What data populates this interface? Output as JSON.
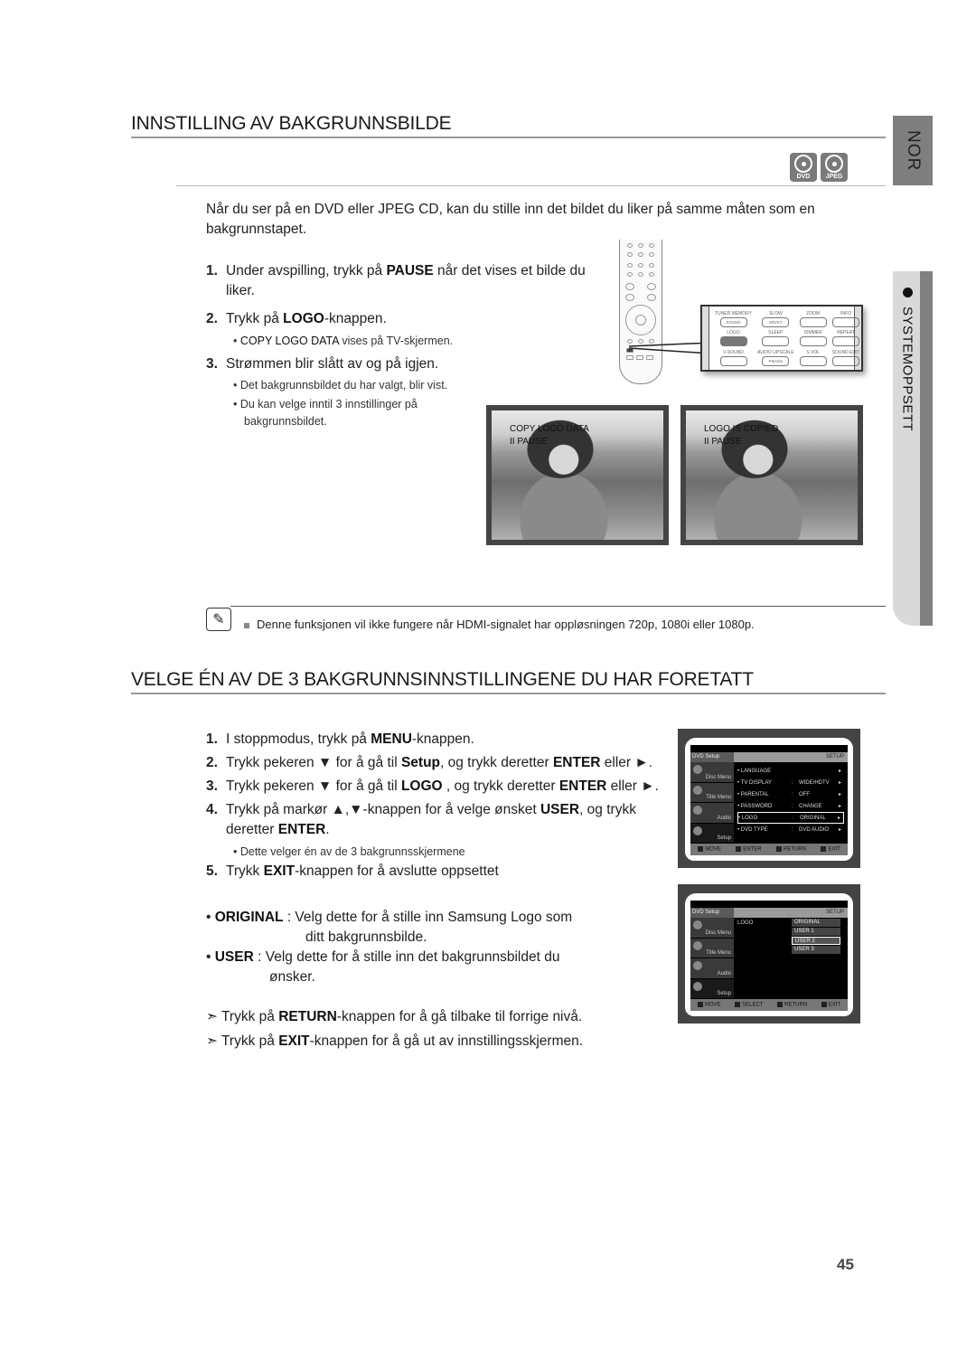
{
  "side_tabs": {
    "language": "NOR",
    "section": "SYSTEMOPPSETT"
  },
  "section1": {
    "title": "INNSTILLING AV BAKGRUNNSBILDE",
    "badges": [
      {
        "icon": "dvd-disc-icon",
        "label": "DVD"
      },
      {
        "icon": "jpeg-disc-icon",
        "label": "JPEG"
      }
    ],
    "intro_line1": "Når du ser på en DVD eller JPEG CD, kan du stille inn det bildet du liker på samme måten som en",
    "intro_line2": "bakgrunnstapet.",
    "steps": [
      {
        "num": "1.",
        "pre": "Under avspilling, trykk på ",
        "bold": "PAUSE",
        "post": " når det vises et bilde du",
        "line2": "liker."
      },
      {
        "num": "2.",
        "pre": "Trykk på ",
        "bold": "LOGO",
        "post": "-knappen.",
        "sub": [
          {
            "bold": "COPY LOGO DATA",
            "post": " vises på TV-skjermen."
          }
        ]
      },
      {
        "num": "3.",
        "pre": "Strømmen blir slått av og på igjen.",
        "sub": [
          {
            "text": "Det bakgrunnsbildet du har valgt, blir vist."
          },
          {
            "text": "Du kan velge inntil 3 innstillinger på",
            "line2": "bakgrunnsbildet."
          }
        ]
      }
    ],
    "remote_keys": [
      {
        "top": "TUNER MEMORY",
        "key": "SOUND"
      },
      {
        "top": "SLOW",
        "key": "MO/ST"
      },
      {
        "top": "ZOOM",
        "key": ""
      },
      {
        "top": "INFO",
        "key": ""
      },
      {
        "top": "LOGO",
        "key": "",
        "active": true
      },
      {
        "top": "SLEEP",
        "key": ""
      },
      {
        "top": "DIMMER",
        "key": ""
      },
      {
        "top": "REPEAT",
        "key": ""
      },
      {
        "top": "V-SOUND",
        "key": ""
      },
      {
        "top": "AUDIO UPSCALE",
        "key": "P.BASS"
      },
      {
        "top": "S.VOL",
        "key": ""
      },
      {
        "top": "SOUND EDIT",
        "key": ""
      }
    ],
    "screens": [
      {
        "line1": "COPY LOGO DATA",
        "line2": "II PAUSE"
      },
      {
        "line1": "LOGO IS COPIED",
        "line2": "II PAUSE"
      }
    ],
    "note": "Denne funksjonen vil ikke fungere når HDMI-signalet har oppløsningen 720p, 1080i eller 1080p."
  },
  "section2": {
    "title": "VELGE ÉN AV DE 3 BAKGRUNNSINNSTILLINGENE DU HAR FORETATT",
    "steps": [
      {
        "num": "1.",
        "parts": [
          "I stoppmodus, trykk på ",
          "MENU",
          "-knappen."
        ]
      },
      {
        "num": "2.",
        "parts": [
          "Trykk pekeren ▼  for å gå til ",
          "Setup",
          ", og trykk deretter ",
          "ENTER",
          " eller ►."
        ]
      },
      {
        "num": "3.",
        "parts": [
          "Trykk pekeren ▼ for å gå til ",
          "LOGO",
          " , og trykk deretter ",
          "ENTER",
          " eller ►."
        ]
      },
      {
        "num": "4.",
        "parts": [
          "Trykk på markør ▲,▼-knappen for å velge ønsket ",
          "USER",
          ", og trykk"
        ],
        "line2": [
          "deretter ",
          "ENTER",
          "."
        ],
        "sub": "Dette velger én av de 3 bakgrunnsskjermene"
      },
      {
        "num": "5.",
        "parts": [
          "Trykk ",
          "EXIT",
          "-knappen for å avslutte oppsettet"
        ]
      }
    ],
    "options": [
      {
        "bold": "ORIGINAL",
        "text": " : Velg dette for å stille inn Samsung Logo som",
        "line2": "ditt bakgrunnsbilde."
      },
      {
        "bold": "USER",
        "text": " : Velg dette for å stille inn det bakgrunnsbildet du",
        "line2": "ønsker."
      }
    ],
    "tips": [
      {
        "pre": "Trykk på ",
        "bold": "RETURN",
        "post": "-knappen for å gå tilbake til forrige nivå."
      },
      {
        "pre": "Trykk på ",
        "bold": "EXIT",
        "post": "-knappen for å gå ut av innstillingsskjermen."
      }
    ],
    "menu1": {
      "header_left": "DVD Setup",
      "header_right": "SETUP",
      "sidebar": [
        "Disc Menu",
        "Title Menu",
        "Audio",
        "Setup"
      ],
      "rows": [
        {
          "name": "LANGUAGE",
          "value": ""
        },
        {
          "name": "TV DISPLAY",
          "value": "WIDE/HDTV"
        },
        {
          "name": "PARENTAL",
          "value": "OFF"
        },
        {
          "name": "PASSWORD",
          "value": "CHANGE"
        },
        {
          "name": "LOGO",
          "value": "ORIGINAL",
          "selected": true
        },
        {
          "name": "DVD TYPE",
          "value": "DVD AUDIO"
        }
      ],
      "footer": [
        "MOVE",
        "ENTER",
        "RETURN",
        "EXIT"
      ]
    },
    "menu2": {
      "header_left": "DVD Setup",
      "header_right": "SETUP",
      "sidebar": [
        "Disc Menu",
        "Title Menu",
        "Audio",
        "Setup"
      ],
      "item": "LOGO",
      "options": [
        "ORIGINAL",
        "USER 1",
        "USER 2",
        "USER 3"
      ],
      "selected_index": 2,
      "footer": [
        "MOVE",
        "SELECT",
        "RETURN",
        "EXIT"
      ]
    }
  },
  "page_number": "45"
}
